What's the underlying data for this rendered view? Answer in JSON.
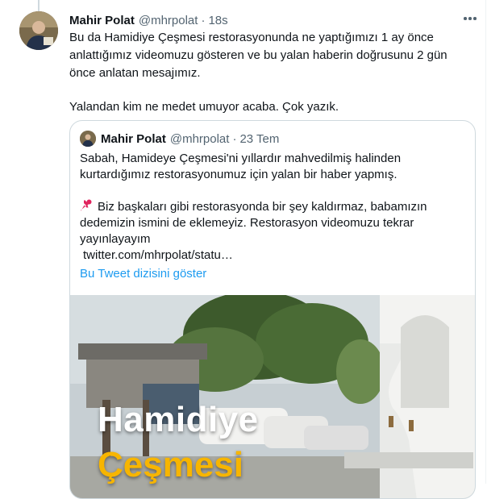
{
  "tweet": {
    "author_name": "Mahir Polat",
    "author_handle": "@mhrpolat",
    "separator": "·",
    "time": "18s",
    "text_line1": "Bu da Hamidiye Çeşmesi restorasyonunda ne yaptığımızı 1 ay önce anlattığımız videomuzu gösteren ve bu yalan haberin doğrusunu 2 gün önce anlatan mesajımız.",
    "text_line2": "Yalandan kim ne medet umuyor acaba. Çok yazık."
  },
  "quote": {
    "author_name": "Mahir Polat",
    "author_handle": "@mhrpolat",
    "separator": "·",
    "date": "23 Tem",
    "para1": "Sabah, Hamideye Çeşmesi'ni yıllardır mahvedilmiş halinden kurtardığımız restorasyonumuz için yalan bir haber yapmış.",
    "para2": "Biz başkaları gibi restorasyonda bir şey kaldırmaz, babamızın dedemizin ismini de eklemeyiz. Restorasyon videomuzu tekrar yayınlayayım",
    "link_text": "twitter.com/mhrpolat/statu…",
    "show_thread": "Bu Tweet dizisini göster",
    "media_caption_line1": "Hamidiye",
    "media_caption_line2": "Çeşmesi"
  },
  "icons": {
    "more": "more-horizontal-icon",
    "pin": "pushpin-icon"
  },
  "colors": {
    "link": "#1d9bf0",
    "secondary_text": "#536471",
    "border": "#cfd9de",
    "caption_accent": "#f7b500"
  }
}
